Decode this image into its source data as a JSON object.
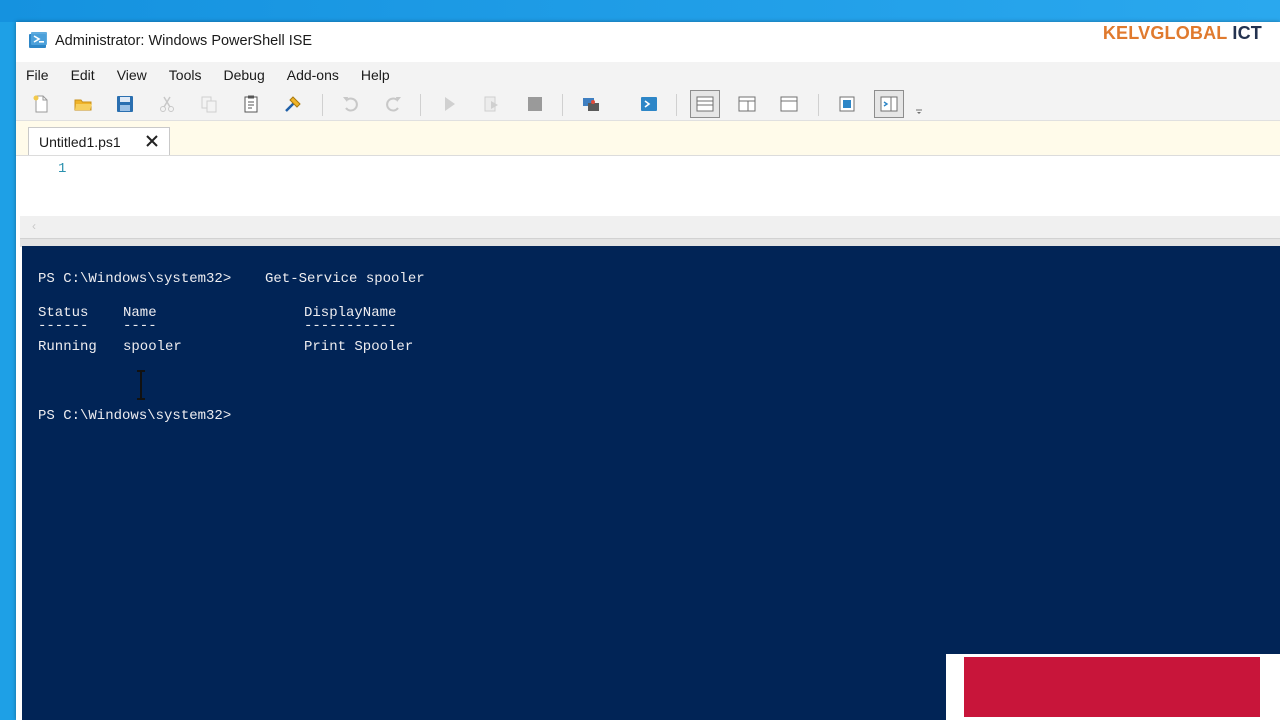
{
  "window": {
    "title": "Administrator: Windows PowerShell ISE",
    "brand_primary": "KELVGLOBAL",
    "brand_secondary": "ICT"
  },
  "menu": {
    "items": [
      "File",
      "Edit",
      "View",
      "Tools",
      "Debug",
      "Add-ons",
      "Help"
    ]
  },
  "toolbar": {
    "buttons": [
      "new-script-icon",
      "open-icon",
      "save-icon",
      "cut-icon",
      "copy-icon",
      "paste-icon",
      "clear-console-icon",
      "undo-icon",
      "redo-icon",
      "run-script-icon",
      "run-selection-icon",
      "stop-icon",
      "new-remote-tab-icon",
      "start-powershell-icon",
      "script-pane-top-icon",
      "script-pane-right-icon",
      "script-pane-maximized-icon",
      "command-addon-icon",
      "show-command-window-icon"
    ]
  },
  "tabs": [
    {
      "label": "Untitled1.ps1",
      "active": true
    }
  ],
  "editor": {
    "line_numbers": [
      "1"
    ]
  },
  "console": {
    "prompt1": "PS C:\\Windows\\system32>",
    "command1": "Get-Service spooler",
    "headers": {
      "status": "Status",
      "name": "Name",
      "display": "DisplayName"
    },
    "underlines": {
      "status": "------",
      "name": "----",
      "display": "-----------"
    },
    "row": {
      "status": "Running",
      "name": "spooler",
      "display": "Print Spooler"
    },
    "prompt2": "PS C:\\Windows\\system32>"
  },
  "colors": {
    "console_bg": "#012456",
    "console_fg": "#eeedf0",
    "brand_orange": "#e07a2e",
    "brand_dark": "#23324f",
    "overlay_red": "#c8153a"
  }
}
